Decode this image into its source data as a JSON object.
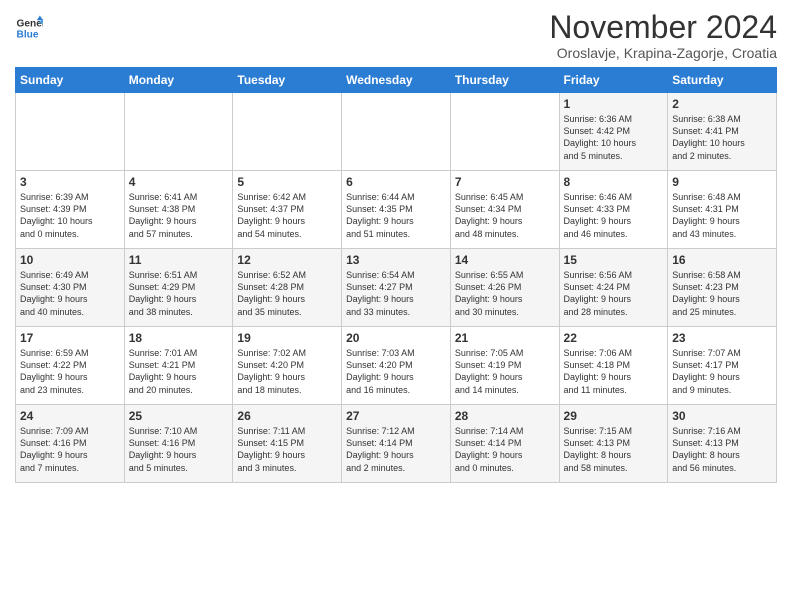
{
  "logo": {
    "line1": "General",
    "line2": "Blue"
  },
  "title": "November 2024",
  "subtitle": "Oroslavje, Krapina-Zagorje, Croatia",
  "headers": [
    "Sunday",
    "Monday",
    "Tuesday",
    "Wednesday",
    "Thursday",
    "Friday",
    "Saturday"
  ],
  "weeks": [
    [
      {
        "day": "",
        "info": ""
      },
      {
        "day": "",
        "info": ""
      },
      {
        "day": "",
        "info": ""
      },
      {
        "day": "",
        "info": ""
      },
      {
        "day": "",
        "info": ""
      },
      {
        "day": "1",
        "info": "Sunrise: 6:36 AM\nSunset: 4:42 PM\nDaylight: 10 hours\nand 5 minutes."
      },
      {
        "day": "2",
        "info": "Sunrise: 6:38 AM\nSunset: 4:41 PM\nDaylight: 10 hours\nand 2 minutes."
      }
    ],
    [
      {
        "day": "3",
        "info": "Sunrise: 6:39 AM\nSunset: 4:39 PM\nDaylight: 10 hours\nand 0 minutes."
      },
      {
        "day": "4",
        "info": "Sunrise: 6:41 AM\nSunset: 4:38 PM\nDaylight: 9 hours\nand 57 minutes."
      },
      {
        "day": "5",
        "info": "Sunrise: 6:42 AM\nSunset: 4:37 PM\nDaylight: 9 hours\nand 54 minutes."
      },
      {
        "day": "6",
        "info": "Sunrise: 6:44 AM\nSunset: 4:35 PM\nDaylight: 9 hours\nand 51 minutes."
      },
      {
        "day": "7",
        "info": "Sunrise: 6:45 AM\nSunset: 4:34 PM\nDaylight: 9 hours\nand 48 minutes."
      },
      {
        "day": "8",
        "info": "Sunrise: 6:46 AM\nSunset: 4:33 PM\nDaylight: 9 hours\nand 46 minutes."
      },
      {
        "day": "9",
        "info": "Sunrise: 6:48 AM\nSunset: 4:31 PM\nDaylight: 9 hours\nand 43 minutes."
      }
    ],
    [
      {
        "day": "10",
        "info": "Sunrise: 6:49 AM\nSunset: 4:30 PM\nDaylight: 9 hours\nand 40 minutes."
      },
      {
        "day": "11",
        "info": "Sunrise: 6:51 AM\nSunset: 4:29 PM\nDaylight: 9 hours\nand 38 minutes."
      },
      {
        "day": "12",
        "info": "Sunrise: 6:52 AM\nSunset: 4:28 PM\nDaylight: 9 hours\nand 35 minutes."
      },
      {
        "day": "13",
        "info": "Sunrise: 6:54 AM\nSunset: 4:27 PM\nDaylight: 9 hours\nand 33 minutes."
      },
      {
        "day": "14",
        "info": "Sunrise: 6:55 AM\nSunset: 4:26 PM\nDaylight: 9 hours\nand 30 minutes."
      },
      {
        "day": "15",
        "info": "Sunrise: 6:56 AM\nSunset: 4:24 PM\nDaylight: 9 hours\nand 28 minutes."
      },
      {
        "day": "16",
        "info": "Sunrise: 6:58 AM\nSunset: 4:23 PM\nDaylight: 9 hours\nand 25 minutes."
      }
    ],
    [
      {
        "day": "17",
        "info": "Sunrise: 6:59 AM\nSunset: 4:22 PM\nDaylight: 9 hours\nand 23 minutes."
      },
      {
        "day": "18",
        "info": "Sunrise: 7:01 AM\nSunset: 4:21 PM\nDaylight: 9 hours\nand 20 minutes."
      },
      {
        "day": "19",
        "info": "Sunrise: 7:02 AM\nSunset: 4:20 PM\nDaylight: 9 hours\nand 18 minutes."
      },
      {
        "day": "20",
        "info": "Sunrise: 7:03 AM\nSunset: 4:20 PM\nDaylight: 9 hours\nand 16 minutes."
      },
      {
        "day": "21",
        "info": "Sunrise: 7:05 AM\nSunset: 4:19 PM\nDaylight: 9 hours\nand 14 minutes."
      },
      {
        "day": "22",
        "info": "Sunrise: 7:06 AM\nSunset: 4:18 PM\nDaylight: 9 hours\nand 11 minutes."
      },
      {
        "day": "23",
        "info": "Sunrise: 7:07 AM\nSunset: 4:17 PM\nDaylight: 9 hours\nand 9 minutes."
      }
    ],
    [
      {
        "day": "24",
        "info": "Sunrise: 7:09 AM\nSunset: 4:16 PM\nDaylight: 9 hours\nand 7 minutes."
      },
      {
        "day": "25",
        "info": "Sunrise: 7:10 AM\nSunset: 4:16 PM\nDaylight: 9 hours\nand 5 minutes."
      },
      {
        "day": "26",
        "info": "Sunrise: 7:11 AM\nSunset: 4:15 PM\nDaylight: 9 hours\nand 3 minutes."
      },
      {
        "day": "27",
        "info": "Sunrise: 7:12 AM\nSunset: 4:14 PM\nDaylight: 9 hours\nand 2 minutes."
      },
      {
        "day": "28",
        "info": "Sunrise: 7:14 AM\nSunset: 4:14 PM\nDaylight: 9 hours\nand 0 minutes."
      },
      {
        "day": "29",
        "info": "Sunrise: 7:15 AM\nSunset: 4:13 PM\nDaylight: 8 hours\nand 58 minutes."
      },
      {
        "day": "30",
        "info": "Sunrise: 7:16 AM\nSunset: 4:13 PM\nDaylight: 8 hours\nand 56 minutes."
      }
    ]
  ]
}
